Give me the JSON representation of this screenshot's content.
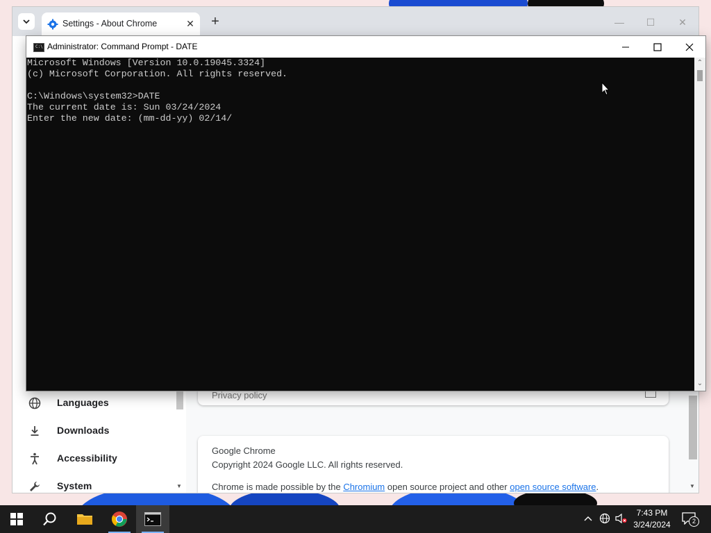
{
  "chrome": {
    "tab_title": "Settings - About Chrome",
    "tab_close": "✕",
    "new_tab": "+",
    "minimize": "—",
    "maximize": "☐",
    "close": "✕",
    "sidebar_items": [
      {
        "label": "Languages",
        "icon": "globe-icon"
      },
      {
        "label": "Downloads",
        "icon": "download-icon"
      },
      {
        "label": "Accessibility",
        "icon": "accessibility-icon"
      },
      {
        "label": "System",
        "icon": "wrench-icon"
      }
    ],
    "privacy_policy": "Privacy policy",
    "about": {
      "product": "Google Chrome",
      "copyright": "Copyright 2024 Google LLC. All rights reserved.",
      "made_possible_prefix": "Chrome is made possible by the ",
      "chromium_link": "Chromium",
      "made_possible_middle": " open source project and other ",
      "oss_link": "open source software",
      "made_possible_suffix": "."
    }
  },
  "cmd": {
    "title": "Administrator: Command Prompt - DATE",
    "lines": [
      "Microsoft Windows [Version 10.0.19045.3324]",
      "(c) Microsoft Corporation. All rights reserved.",
      "",
      "C:\\Windows\\system32>DATE",
      "The current date is: Sun 03/24/2024",
      "Enter the new date: (mm-dd-yy) 02/14/"
    ]
  },
  "taskbar": {
    "apps": [
      "start-icon",
      "search-icon",
      "file-explorer-icon",
      "chrome-icon",
      "command-prompt-icon"
    ],
    "time": "7:43 PM",
    "date": "3/24/2024",
    "notification_count": "2"
  },
  "colors": {
    "cmd_bg": "#0c0c0c",
    "cmd_text": "#cccccc",
    "taskbar": "#1c1c1c",
    "link": "#1a73e8",
    "chrome_tabbar": "#dee1e6"
  }
}
